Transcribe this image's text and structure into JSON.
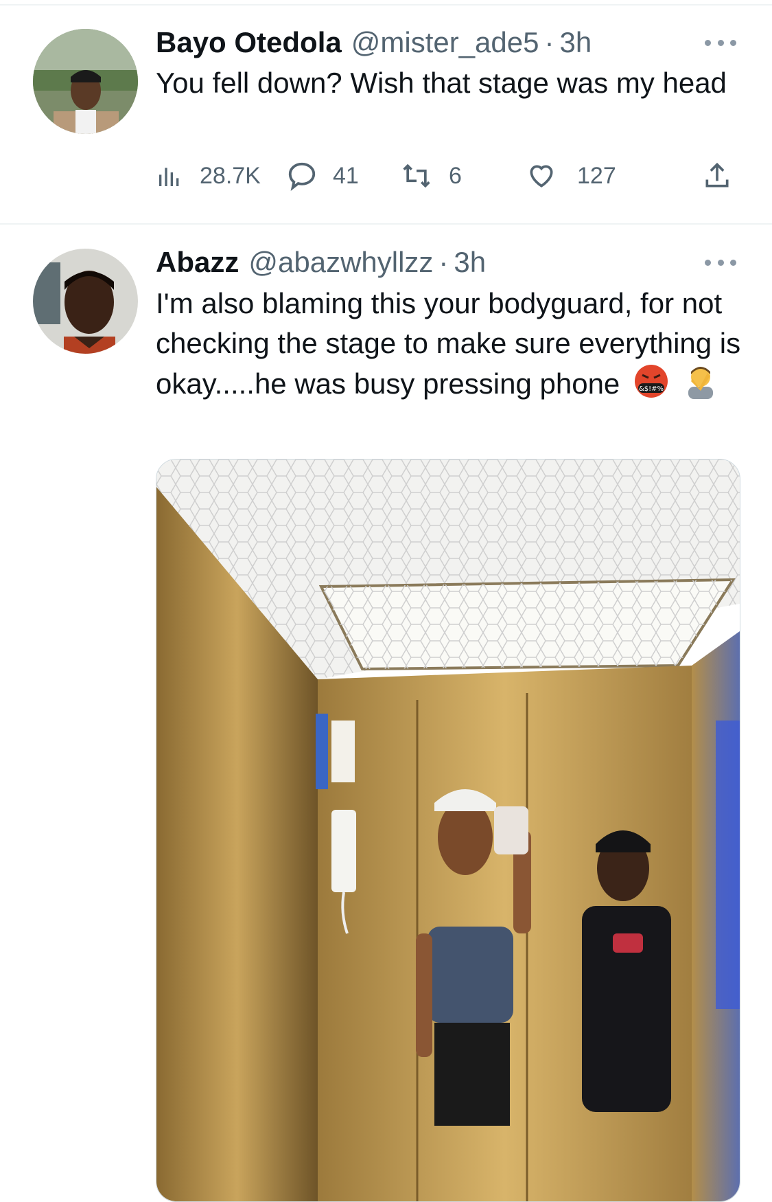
{
  "tweets": [
    {
      "name": "Bayo Otedola",
      "handle": "@mister_ade5",
      "separator": "·",
      "time": "3h",
      "text": "You fell down? Wish that stage was my head",
      "stats": {
        "views": "28.7K",
        "replies": "41",
        "retweets": "6",
        "likes": "127"
      },
      "avatar_icon": "avatar-photo"
    },
    {
      "name": "Abazz",
      "handle": "@abazwhyllzz",
      "separator": "·",
      "time": "3h",
      "text": "I'm also blaming this your bodyguard, for not checking the stage to make sure everything is okay.....he was busy pressing phone",
      "emojis": [
        "face-with-symbols-on-mouth",
        "person-facepalming"
      ],
      "emoji_text": "&$!#%",
      "avatar_icon": "avatar-photo",
      "media": {
        "type": "photo",
        "description_icon": "elevator-selfie-photo"
      }
    }
  ],
  "colors": {
    "text": "#0f1419",
    "secondary": "#536471",
    "divider": "#eff3f4",
    "background": "#ffffff"
  },
  "icons": [
    "more-icon",
    "views-icon",
    "reply-icon",
    "retweet-icon",
    "like-icon",
    "share-icon"
  ]
}
